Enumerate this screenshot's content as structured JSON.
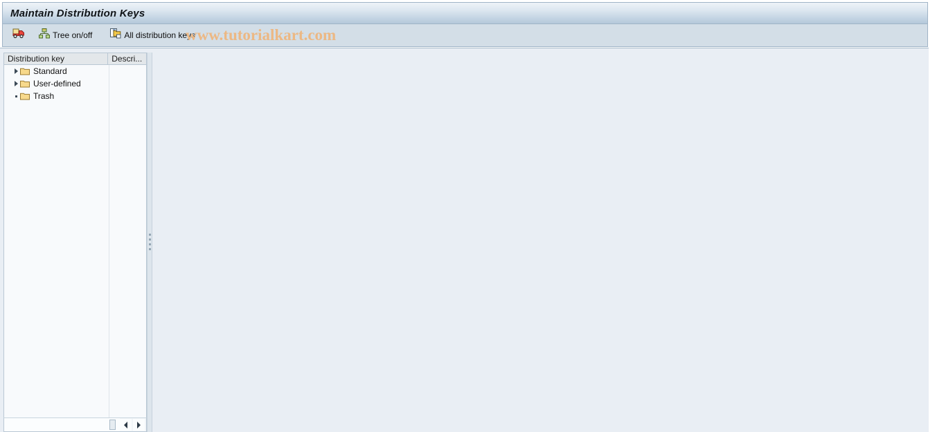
{
  "window": {
    "title": "Maintain Distribution Keys"
  },
  "toolbar": {
    "buttons": [
      {
        "name": "truck-delivery-button",
        "icon": "truck-icon",
        "label": ""
      },
      {
        "name": "tree-on-off-button",
        "icon": "hierarchy-tree-icon",
        "label": "Tree on/off"
      },
      {
        "name": "all-distribution-keys-button",
        "icon": "copy-document-icon",
        "label": "All distribution keys"
      }
    ]
  },
  "watermark": {
    "text": "www.tutorialkart.com",
    "color": "#ecb884"
  },
  "tree": {
    "columns": [
      {
        "label": "Distribution key"
      },
      {
        "label": "Descri..."
      }
    ],
    "nodes": [
      {
        "label": "Standard",
        "state": "collapsed",
        "icon": "folder-icon"
      },
      {
        "label": "User-defined",
        "state": "collapsed",
        "icon": "folder-icon"
      },
      {
        "label": "Trash",
        "state": "leaf",
        "icon": "folder-icon"
      }
    ]
  },
  "scrollbar": {
    "left_arrow": "arrow-left-icon",
    "right_arrow": "arrow-right-icon"
  },
  "colors": {
    "titlebar_border": "#9fb3c6",
    "toolbar_bg": "#d3dee7",
    "workarea_bg": "#e9eef4",
    "tree_bg": "#f8fafc",
    "folder_fill": "#f7d98c"
  }
}
